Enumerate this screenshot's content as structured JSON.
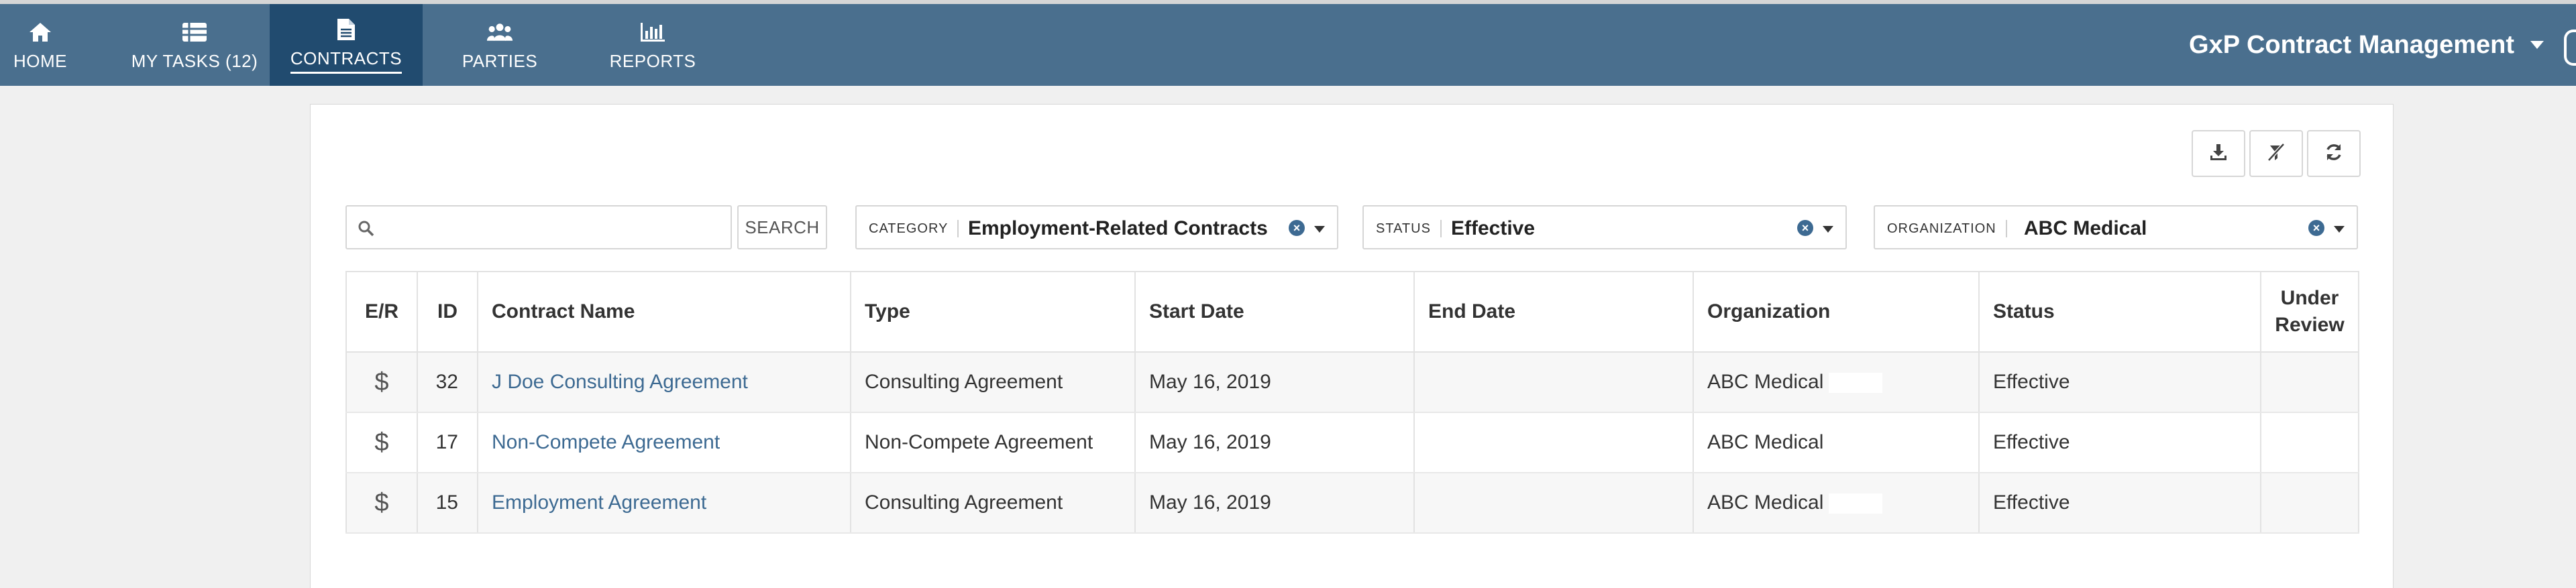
{
  "nav": {
    "items": [
      {
        "label": "HOME",
        "icon": "home-icon"
      },
      {
        "label": "MY TASKS (12)",
        "icon": "list-icon"
      },
      {
        "label": "CONTRACTS",
        "icon": "document-icon",
        "active": true
      },
      {
        "label": "PARTIES",
        "icon": "people-icon"
      },
      {
        "label": "REPORTS",
        "icon": "bar-chart-icon"
      }
    ],
    "app_title": "GxP Contract Management"
  },
  "toolbar": {
    "buttons": [
      "download-icon",
      "clear-filters-icon",
      "refresh-icon"
    ]
  },
  "search": {
    "placeholder": "",
    "value": "",
    "button_label": "SEARCH"
  },
  "filters": {
    "category": {
      "label": "CATEGORY",
      "value": "Employment-Related Contracts"
    },
    "status": {
      "label": "STATUS",
      "value": "Effective"
    },
    "organization": {
      "label": "ORGANIZATION",
      "value": "ABC Medical"
    }
  },
  "table": {
    "columns": [
      "E/R",
      "ID",
      "Contract Name",
      "Type",
      "Start Date",
      "End Date",
      "Organization",
      "Status",
      "Under Review"
    ],
    "rows": [
      {
        "er": "$",
        "id": "32",
        "name": "J Doe Consulting Agreement",
        "type": "Consulting Agreement",
        "start": "May 16, 2019",
        "end": "",
        "org": "ABC Medical",
        "status": "Effective",
        "review": ""
      },
      {
        "er": "$",
        "id": "17",
        "name": "Non-Compete Agreement",
        "type": "Non-Compete Agreement",
        "start": "May 16, 2019",
        "end": "",
        "org": "ABC Medical",
        "status": "Effective",
        "review": ""
      },
      {
        "er": "$",
        "id": "15",
        "name": "Employment Agreement",
        "type": "Consulting Agreement",
        "start": "May 16, 2019",
        "end": "",
        "org": "ABC Medical",
        "status": "Effective",
        "review": ""
      }
    ]
  },
  "colors": {
    "navbar": "#4a6f8e",
    "nav_active": "#214b6f",
    "link": "#3d6a92"
  }
}
